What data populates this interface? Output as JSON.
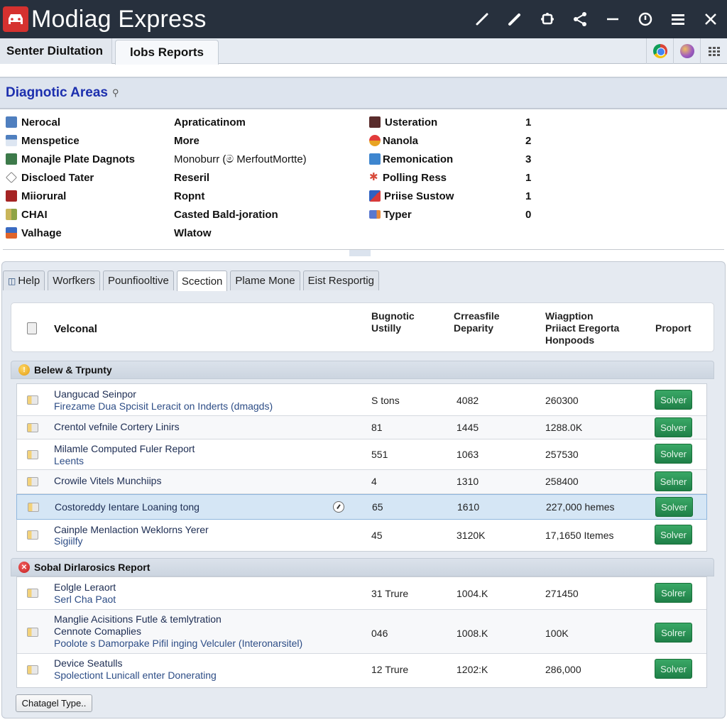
{
  "app": {
    "title": "Modiag Express",
    "logo_icon": "car-icon",
    "title_bar_icons": [
      "pen-icon",
      "pencil-icon",
      "puzzle-icon",
      "share-icon",
      "minimize-icon",
      "clock-icon",
      "menu-icon",
      "close-icon"
    ]
  },
  "top_tabs": [
    {
      "label": "Senter Diultation",
      "active": false
    },
    {
      "label": "lobs Reports",
      "active": true
    }
  ],
  "top_right_icons": [
    "chrome-icon",
    "globe-icon",
    "apps-grid-icon"
  ],
  "diagnostic_areas": {
    "title": "Diagnotic Areas",
    "left_items": [
      {
        "icon": "monitor-icon",
        "name": "Nerocal",
        "value": "Apraticatinom"
      },
      {
        "icon": "document-icon",
        "name": "Menspetice",
        "value": "More"
      },
      {
        "icon": "plate-icon",
        "name": "Monajle Plate Dagnots",
        "value": "Monoburr (ම MerfoutMortte)"
      },
      {
        "icon": "diamond-icon",
        "name": "Discloed Tater",
        "value": "Reseril"
      },
      {
        "icon": "camera-icon",
        "name": "Miiorural",
        "value": "Ropnt"
      },
      {
        "icon": "chart-icon",
        "name": "CHAI",
        "value": "Casted Bald-joration"
      },
      {
        "icon": "flag-icon",
        "name": "Valhage",
        "value": "Wlatow"
      }
    ],
    "right_items": [
      {
        "icon": "image-icon",
        "name": "Usteration",
        "count": "1"
      },
      {
        "icon": "half-circle-icon",
        "name": "Nanola",
        "count": "2"
      },
      {
        "icon": "info-icon",
        "name": "Remonication",
        "count": "3"
      },
      {
        "icon": "tools-icon",
        "name": "Polling Ress",
        "count": "1"
      },
      {
        "icon": "person-icon",
        "name": "Priise Sustow",
        "count": "1"
      },
      {
        "icon": "chat-icon",
        "name": "Typer",
        "count": "0"
      }
    ]
  },
  "sub_tabs": [
    {
      "label": "Help",
      "active": false
    },
    {
      "label": "Worfkers",
      "active": false
    },
    {
      "label": "Pounfiooltive",
      "active": false
    },
    {
      "label": "Scection",
      "active": true
    },
    {
      "label": "Plame Mone",
      "active": false
    },
    {
      "label": "Eist Resportig",
      "active": false
    }
  ],
  "table_header": {
    "first": "Velconal",
    "columns": [
      "Bugnotic\nUstilly",
      "Crreasfile\nDeparity",
      "Wiagption\nPriiact Eregorta\nHonpoods",
      "Proport"
    ]
  },
  "groups": [
    {
      "title": "Belew & Trpunty",
      "status": "warning",
      "rows": [
        {
          "title": "Uangucad Seinpor",
          "sub": "Firezame Dua Spcisit Leracit on Inderts (dmagds)",
          "c1": "S tons",
          "c2": "4082",
          "c3": "260300",
          "action": "Solver"
        },
        {
          "title": "Crentol vefnile Cortery Linirs",
          "sub": "",
          "c1": "81",
          "c2": "1445",
          "c3": "1288.0K",
          "action": "Solver"
        },
        {
          "title": "Milamle Computed Fuler Report",
          "sub": "Leents",
          "c1": "551",
          "c2": "1063",
          "c3": "257530",
          "action": "Solver"
        },
        {
          "title": "Crowile Vitels Munchiips",
          "sub": "",
          "c1": "4",
          "c2": "1310",
          "c3": "258400",
          "action": "Selner"
        },
        {
          "title": "Costoreddy Ientare Loaning tong",
          "sub": "",
          "c1": "65",
          "c2": "1610",
          "c3": "227,000 hemes",
          "action": "Solver",
          "selected": true
        },
        {
          "title": "Cainple Menlaction Weklorns Yerer",
          "sub": "Sigiilfy",
          "c1": "45",
          "c2": "3120K",
          "c3": "17,1650 Itemes",
          "action": "Solver"
        }
      ]
    },
    {
      "title": "Sobal Dirlarosics Report",
      "status": "error",
      "rows": [
        {
          "title": "Eolgle Leraort",
          "sub": "Serl Cha Paot",
          "c1": "31 Trure",
          "c2": "1004.K",
          "c3": "271450",
          "action": "Solrer"
        },
        {
          "title": "Manglie Acisitions Futle & temlytration",
          "title2": "Cennote Comaplies",
          "sub": "Poolote s Damorpake Pifil inging Velculer (Interonarsitel)",
          "c1": "046",
          "c2": "1008.K",
          "c3": "100K",
          "action": "Solrer"
        },
        {
          "title": "Device Seatulls",
          "sub": "Spolectiont Lunicall enter Donerating",
          "c1": "12 Trure",
          "c2": "1202:K",
          "c3": "286,000",
          "action": "Solver"
        }
      ]
    }
  ],
  "footer": {
    "change_type_label": "Chatagel Type.."
  }
}
